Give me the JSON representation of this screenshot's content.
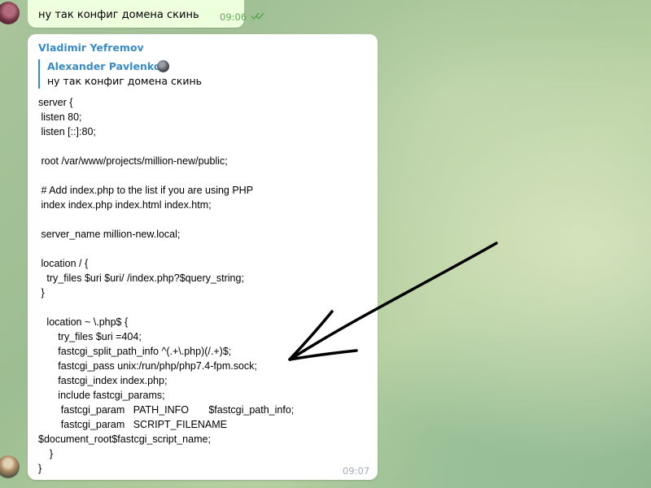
{
  "outgoing": {
    "text": "ну так конфиг домена скинь",
    "time": "09:06",
    "status_icon": "double-check-icon",
    "time_color": "#5ca853"
  },
  "incoming": {
    "sender": "Vladimir Yefremov",
    "reply": {
      "name": "Alexander Pavlenko",
      "text": "ну так конфиг домена скинь"
    },
    "code": "server {\n listen 80;\n listen [::]:80;\n\n root /var/www/projects/million-new/public;\n\n # Add index.php to the list if you are using PHP\n index index.php index.html index.htm;\n\n server_name million-new.local;\n\n location / {\n   try_files $uri $uri/ /index.php?$query_string;\n }\n\n   location ~ \\.php$ {\n       try_files $uri =404;\n       fastcgi_split_path_info ^(.+\\.php)(/.+)$;\n       fastcgi_pass unix:/run/php/php7.4-fpm.sock;\n       fastcgi_index index.php;\n       include fastcgi_params;\n        fastcgi_param   PATH_INFO       $fastcgi_path_info;\n        fastcgi_param   SCRIPT_FILENAME\n$document_root$fastcgi_script_name;\n    }\n}",
    "time": "09:07",
    "name_color": "#3a8bc4"
  },
  "annotation": {
    "shape": "hand-drawn-arrow",
    "color": "#000000"
  }
}
